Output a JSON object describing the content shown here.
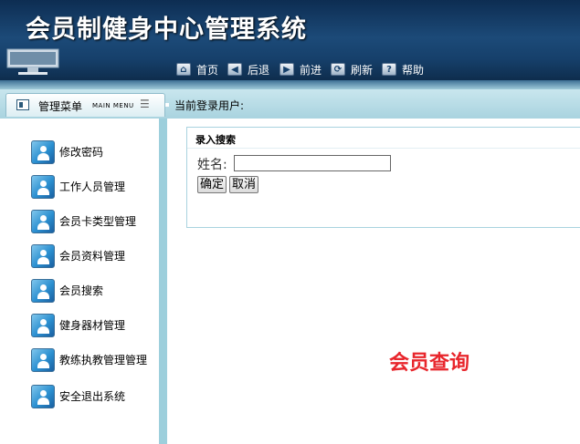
{
  "header": {
    "title": "会员制健身中心管理系统"
  },
  "nav": [
    {
      "label": "首页",
      "icon": "home-icon"
    },
    {
      "label": "后退",
      "icon": "back-arrow-icon"
    },
    {
      "label": "前进",
      "icon": "forward-arrow-icon"
    },
    {
      "label": "刷新",
      "icon": "refresh-icon"
    },
    {
      "label": "帮助",
      "icon": "help-icon"
    }
  ],
  "menu": {
    "title": "管理菜单",
    "subtitle": "MAIN MENU",
    "current_user_label": "当前登录用户:"
  },
  "sidebar": {
    "items": [
      {
        "label": "修改密码"
      },
      {
        "label": "工作人员管理"
      },
      {
        "label": "会员卡类型管理"
      },
      {
        "label": "会员资料管理"
      },
      {
        "label": "会员搜索"
      },
      {
        "label": "健身器材管理"
      },
      {
        "label": "教练执教管理管理"
      },
      {
        "label": "安全退出系统"
      }
    ]
  },
  "search": {
    "title": "录入搜索",
    "name_label": "姓名:",
    "name_value": "",
    "confirm_label": "确定",
    "cancel_label": "取消"
  },
  "caption": "会员查询",
  "colors": {
    "header": "#16406b",
    "menubar": "#a9d3df",
    "caption": "#e8262c"
  }
}
